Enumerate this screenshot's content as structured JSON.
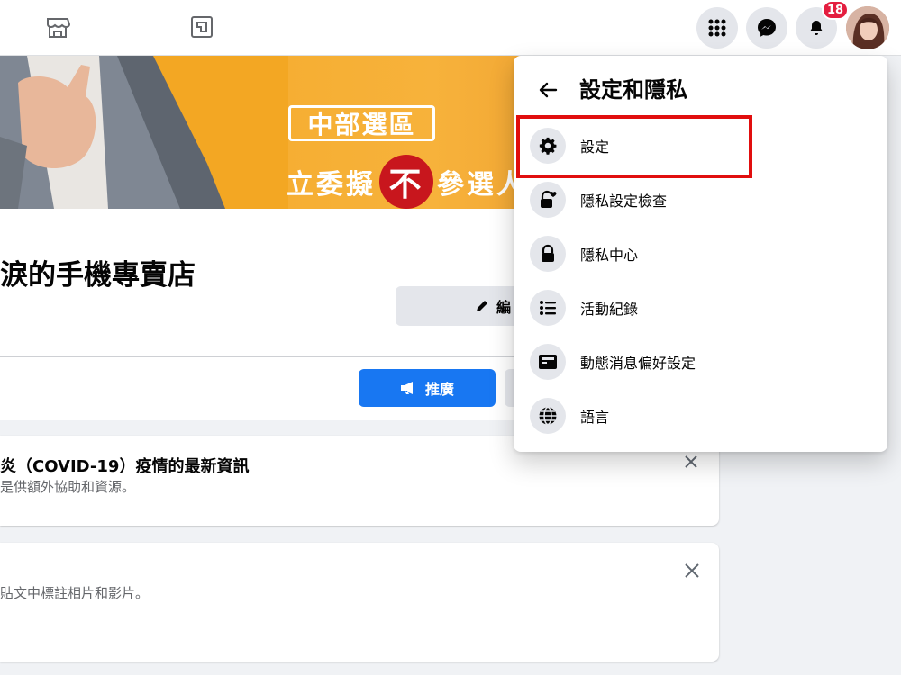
{
  "header": {
    "notification_count": "18"
  },
  "cover": {
    "tag_text": "中部選區",
    "line_left": "立委擬",
    "line_circle": "不",
    "line_right": "參選人"
  },
  "profile": {
    "page_title": "淚的手機專賣店",
    "edit_label": "編",
    "promote_label": "推廣"
  },
  "cards": [
    {
      "title": "炎（COVID-19）疫情的最新資訊",
      "subtitle": "是供額外協助和資源。"
    },
    {
      "subtitle": "貼文中標註相片和影片。"
    }
  ],
  "settings_menu": {
    "title": "設定和隱私",
    "items": [
      {
        "label": "設定",
        "icon": "gear-icon"
      },
      {
        "label": "隱私設定檢查",
        "icon": "lock-heart-icon"
      },
      {
        "label": "隱私中心",
        "icon": "lock-icon"
      },
      {
        "label": "活動紀錄",
        "icon": "list-icon"
      },
      {
        "label": "動態消息偏好設定",
        "icon": "feed-icon"
      },
      {
        "label": "語言",
        "icon": "globe-icon"
      }
    ]
  },
  "colors": {
    "accent": "#1877f2",
    "highlight": "#e10e0e",
    "badge": "#e41e3f"
  }
}
